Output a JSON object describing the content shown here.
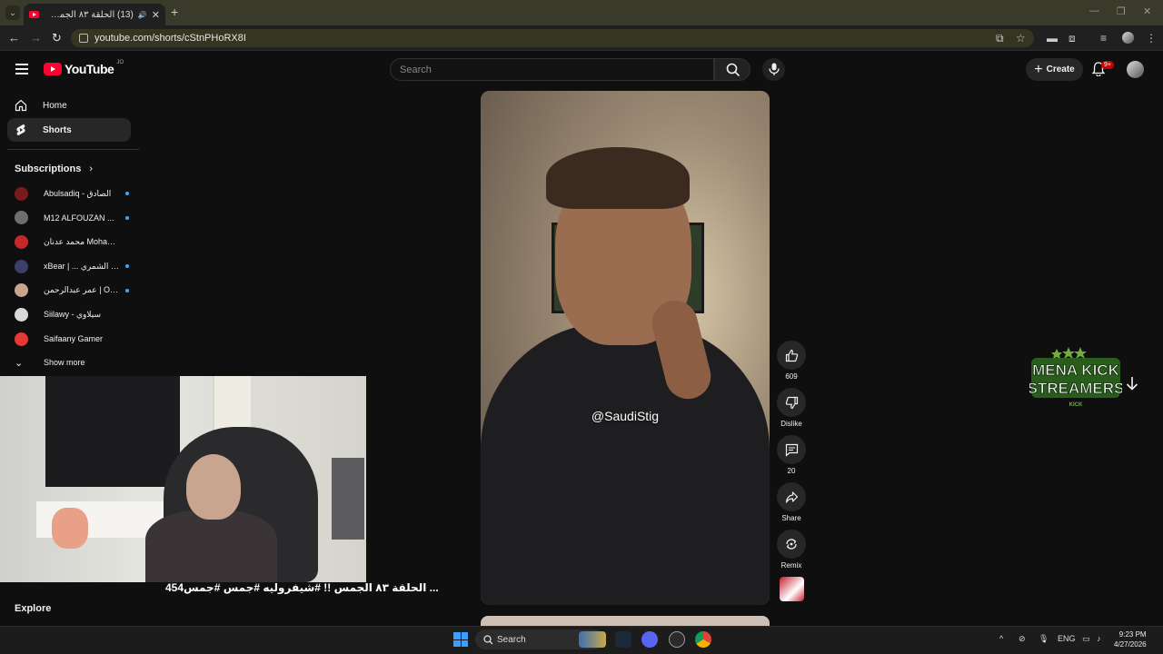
{
  "browser": {
    "tab_title": "(13) الحلقة ٨٣ الجمس !! #شف",
    "new_tab": "+",
    "url": "youtube.com/shorts/cStnPHoRX8I"
  },
  "youtube": {
    "logo_text": "YouTube",
    "country_code": "JO",
    "search_placeholder": "Search",
    "create_label": "Create",
    "notification_count": "9+"
  },
  "sidebar": {
    "items": [
      {
        "label": "Home"
      },
      {
        "label": "Shorts"
      }
    ],
    "subscriptions_title": "Subscriptions",
    "subscriptions": [
      {
        "name": "Abulsadiq - الصادق",
        "live": true,
        "color": "#7a1b1b"
      },
      {
        "name": "M12 ALFOUZAN ...",
        "live": true,
        "color": "#6e6e6e"
      },
      {
        "name": "محمد عدنان Mohamad...",
        "live": false,
        "color": "#c62828"
      },
      {
        "name": "xBear | ... عايد الشمري",
        "live": true,
        "color": "#3b3f6a"
      },
      {
        "name": "عمر عبدالرحمن | Om...",
        "live": true,
        "color": "#c9a48f"
      },
      {
        "name": "Siilawy - سيلاوي",
        "live": false,
        "color": "#d9d9d9"
      },
      {
        "name": "Saifaany Gamer",
        "live": false,
        "color": "#e53935"
      }
    ],
    "show_more": "Show more",
    "explore": "Explore"
  },
  "stream": {
    "caption": "... الحلقة ٨٣ الجمس !! #شيفروليه #جمس #جمس454"
  },
  "short": {
    "handle": "@SaudiStig",
    "actions": {
      "likes": "609",
      "dislike": "Dislike",
      "comments": "20",
      "share": "Share",
      "remix": "Remix"
    }
  },
  "overlay": {
    "logo_line1": "MENA KICK",
    "logo_line2": "STREAMERS",
    "logo_line3": "KICK"
  },
  "taskbar": {
    "search": "Search",
    "language": "ENG",
    "time": "9:23 PM",
    "date": "4/27/2026"
  }
}
